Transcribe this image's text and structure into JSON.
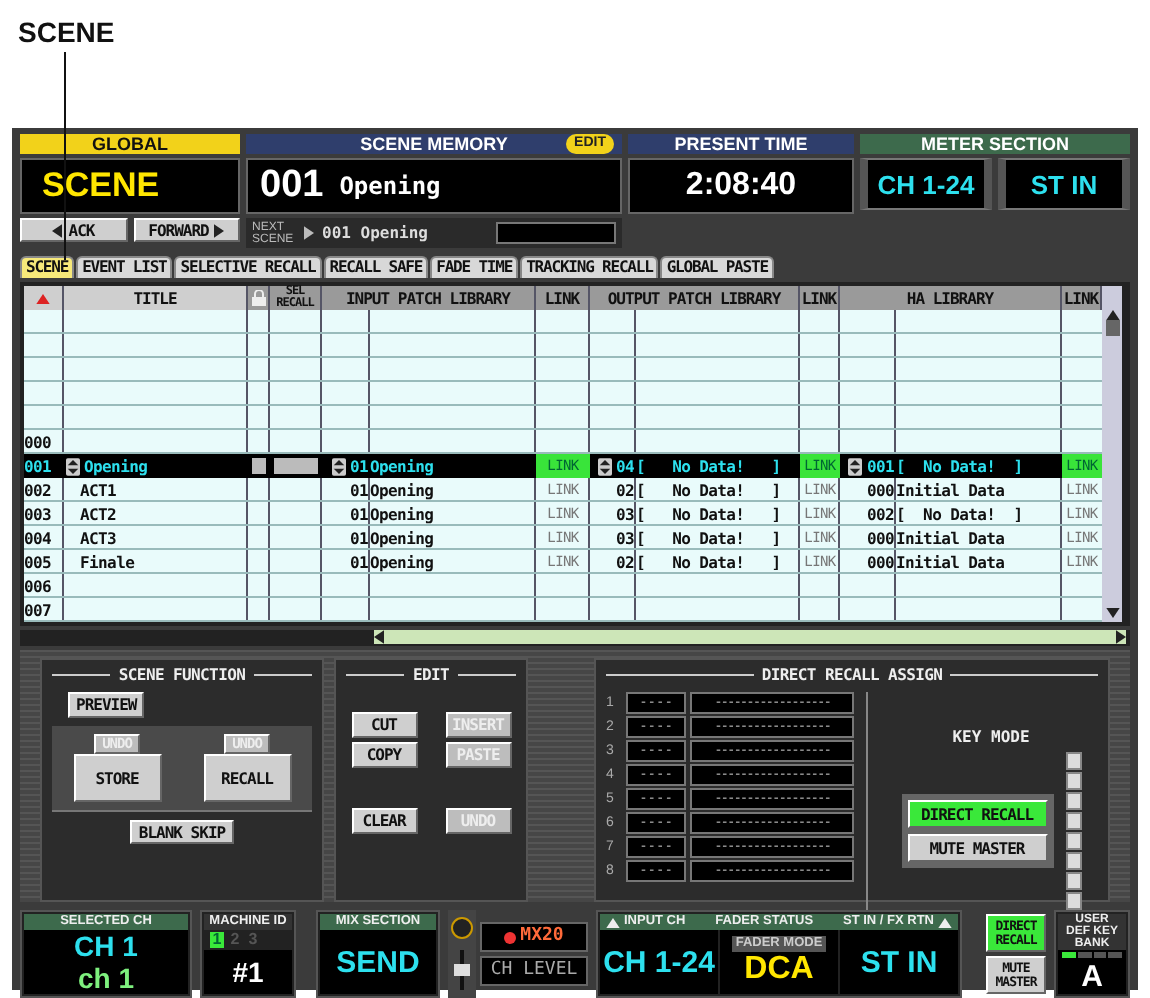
{
  "callout": {
    "label": "SCENE"
  },
  "global": {
    "title": "GLOBAL",
    "mode": "SCENE",
    "back": "ACK",
    "forward": "FORWARD"
  },
  "scene_memory": {
    "title": "SCENE MEMORY",
    "badge": "EDIT",
    "number": "001",
    "name": "Opening",
    "next_label": "NEXT SCENE",
    "next_scene": "001 Opening"
  },
  "present_time": {
    "title": "PRESENT TIME",
    "time": "2:08:40"
  },
  "meter_section": {
    "title": "METER SECTION",
    "buttons": [
      "CH 1-24",
      "ST IN"
    ]
  },
  "tabs": [
    {
      "label": "SCENE",
      "selected": true
    },
    {
      "label": "EVENT LIST",
      "selected": false
    },
    {
      "label": "SELECTIVE RECALL",
      "selected": false
    },
    {
      "label": "RECALL SAFE",
      "selected": false
    },
    {
      "label": "FADE TIME",
      "selected": false
    },
    {
      "label": "TRACKING RECALL",
      "selected": false
    },
    {
      "label": "GLOBAL PASTE",
      "selected": false
    }
  ],
  "table": {
    "columns": [
      "TITLE",
      "SEL RECALL",
      "INPUT PATCH LIBRARY",
      "LINK",
      "OUTPUT PATCH LIBRARY",
      "LINK",
      "HA LIBRARY",
      "LINK"
    ],
    "rows": [
      {
        "number": "000",
        "selected": false
      },
      {
        "number": "001",
        "title": "Opening",
        "selected": true,
        "input": {
          "no": "01",
          "name": "Opening",
          "link": "LINK",
          "linked": true
        },
        "output": {
          "no": "04",
          "name": "[   No Data!   ]",
          "link": "LINK",
          "linked": true
        },
        "ha": {
          "no": "001",
          "name": "[  No Data!  ]",
          "link": "LINK",
          "linked": true
        }
      },
      {
        "number": "002",
        "title": "ACT1",
        "selected": false,
        "input": {
          "no": "01",
          "name": "Opening",
          "link": "LINK",
          "linked": false
        },
        "output": {
          "no": "02",
          "name": "[   No Data!   ]",
          "link": "LINK",
          "linked": false
        },
        "ha": {
          "no": "000",
          "name": "Initial Data",
          "link": "LINK",
          "linked": false
        }
      },
      {
        "number": "003",
        "title": "ACT2",
        "selected": false,
        "input": {
          "no": "01",
          "name": "Opening",
          "link": "LINK",
          "linked": false
        },
        "output": {
          "no": "03",
          "name": "[   No Data!   ]",
          "link": "LINK",
          "linked": false
        },
        "ha": {
          "no": "002",
          "name": "[  No Data!  ]",
          "link": "LINK",
          "linked": false
        }
      },
      {
        "number": "004",
        "title": "ACT3",
        "selected": false,
        "input": {
          "no": "01",
          "name": "Opening",
          "link": "LINK",
          "linked": false
        },
        "output": {
          "no": "03",
          "name": "[   No Data!   ]",
          "link": "LINK",
          "linked": false
        },
        "ha": {
          "no": "000",
          "name": "Initial Data",
          "link": "LINK",
          "linked": false
        }
      },
      {
        "number": "005",
        "title": "Finale",
        "selected": false,
        "input": {
          "no": "01",
          "name": "Opening",
          "link": "LINK",
          "linked": false
        },
        "output": {
          "no": "02",
          "name": "[   No Data!   ]",
          "link": "LINK",
          "linked": false
        },
        "ha": {
          "no": "000",
          "name": "Initial Data",
          "link": "LINK",
          "linked": false
        }
      },
      {
        "number": "006",
        "selected": false
      },
      {
        "number": "007",
        "selected": false
      }
    ]
  },
  "scene_function": {
    "title": "SCENE FUNCTION",
    "preview": "PREVIEW",
    "store": {
      "label": "STORE",
      "undo": {
        "label": "UNDO",
        "disabled": true
      }
    },
    "recall": {
      "label": "RECALL",
      "undo": {
        "label": "UNDO",
        "disabled": true
      }
    },
    "blank_skip": "BLANK SKIP"
  },
  "edit": {
    "title": "EDIT",
    "buttons": [
      {
        "label": "CUT",
        "disabled": false
      },
      {
        "label": "INSERT",
        "disabled": true
      },
      {
        "label": "COPY",
        "disabled": false
      },
      {
        "label": "PASTE",
        "disabled": true
      },
      {
        "label": "CLEAR",
        "disabled": false
      },
      {
        "label": "UNDO",
        "disabled": true
      }
    ]
  },
  "direct_recall": {
    "title": "DIRECT RECALL ASSIGN",
    "slots": [
      {
        "number": "1",
        "key": "----",
        "scene": "------------------"
      },
      {
        "number": "2",
        "key": "----",
        "scene": "------------------"
      },
      {
        "number": "3",
        "key": "----",
        "scene": "------------------"
      },
      {
        "number": "4",
        "key": "----",
        "scene": "------------------"
      },
      {
        "number": "5",
        "key": "----",
        "scene": "------------------"
      },
      {
        "number": "6",
        "key": "----",
        "scene": "------------------"
      },
      {
        "number": "7",
        "key": "----",
        "scene": "------------------"
      },
      {
        "number": "8",
        "key": "----",
        "scene": "------------------"
      }
    ],
    "key_mode": {
      "title": "KEY MODE",
      "options": [
        {
          "label": "DIRECT RECALL",
          "selected": true
        },
        {
          "label": "MUTE MASTER",
          "selected": false
        }
      ]
    }
  },
  "status_bar": {
    "selected_ch": {
      "title": "SELECTED CH",
      "line1": "CH 1",
      "line2": "ch 1"
    },
    "machine_id": {
      "title": "MACHINE ID",
      "ids": [
        {
          "label": "1",
          "selected": true
        },
        {
          "label": "2",
          "selected": false
        },
        {
          "label": "3",
          "selected": false
        }
      ],
      "value": "#1"
    },
    "mix_section": {
      "title": "MIX SECTION",
      "value": "SEND"
    },
    "mix": {
      "bus": "MX20",
      "level": "CH LEVEL"
    },
    "fader_status": {
      "input_label": "INPUT CH",
      "title": "FADER STATUS",
      "stin_label": "ST IN / FX RTN",
      "input_value": "CH 1-24",
      "mode_label": "FADER MODE",
      "mode": "DCA",
      "stin_value": "ST IN"
    },
    "keys": [
      {
        "label": "DIRECT RECALL",
        "on": true
      },
      {
        "label": "MUTE MASTER",
        "on": false
      }
    ],
    "user_def": {
      "title": "USER DEF KEY BANK",
      "bank": "A"
    }
  }
}
